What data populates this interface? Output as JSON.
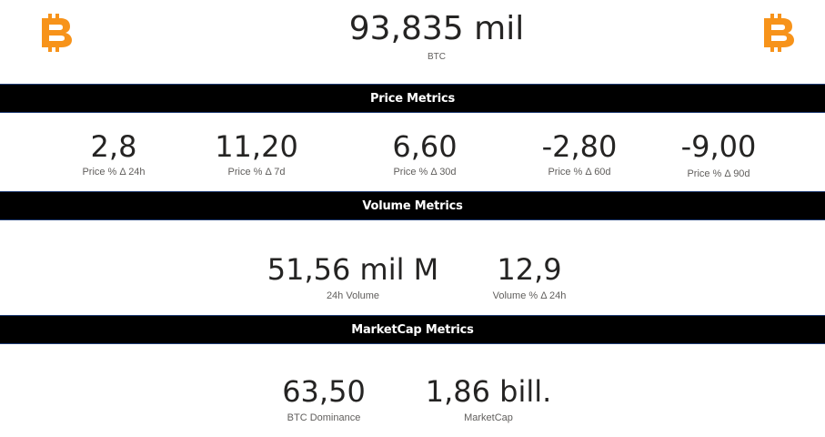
{
  "header": {
    "logo_left_icon": "bitcoin-icon",
    "logo_right_icon": "bitcoin-icon",
    "price_value": "93,835 mil",
    "price_label": "BTC"
  },
  "colors": {
    "bitcoin_orange": "#F7931A",
    "section_bar": "#000000",
    "value_text": "#252423",
    "label_text": "#605e5c"
  },
  "sections": {
    "price": {
      "title": "Price Metrics",
      "metrics": [
        {
          "value": "2,8",
          "label": "Price % Δ 24h"
        },
        {
          "value": "11,20",
          "label": "Price % Δ 7d"
        },
        {
          "value": "6,60",
          "label": "Price % Δ 30d"
        },
        {
          "value": "-2,80",
          "label": "Price % Δ 60d"
        },
        {
          "value": "-9,00",
          "label": "Price % Δ 90d"
        }
      ]
    },
    "volume": {
      "title": "Volume Metrics",
      "metrics": [
        {
          "value": "51,56 mil M",
          "label": "24h Volume"
        },
        {
          "value": "12,9",
          "label": "Volume % Δ 24h"
        }
      ]
    },
    "marketcap": {
      "title": "MarketCap Metrics",
      "metrics": [
        {
          "value": "63,50",
          "label": "BTC Dominance"
        },
        {
          "value": "1,86 bill.",
          "label": "MarketCap"
        }
      ]
    }
  }
}
